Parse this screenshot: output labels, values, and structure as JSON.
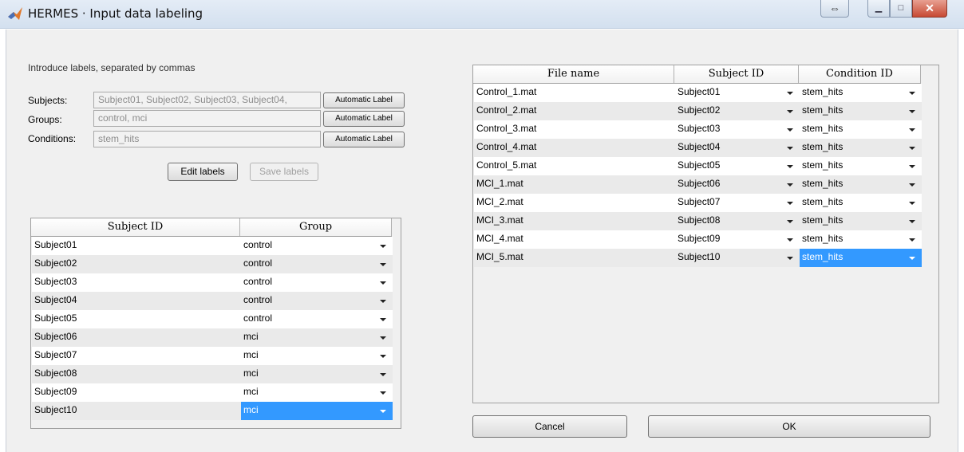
{
  "window": {
    "title": "HERMES · Input data labeling"
  },
  "labels_panel": {
    "instruction": "Introduce labels, separated by commas",
    "subjects_label": "Subjects:",
    "subjects_value": "Subject01, Subject02, Subject03, Subject04,",
    "groups_label": "Groups:",
    "groups_value": "control, mci",
    "conditions_label": "Conditions:",
    "conditions_value": "stem_hits",
    "automatic_label": "Automatic Label",
    "edit_labels": "Edit labels",
    "save_labels": "Save labels"
  },
  "subject_table": {
    "headers": [
      "Subject ID",
      "Group"
    ],
    "rows": [
      {
        "subject": "Subject01",
        "group": "control"
      },
      {
        "subject": "Subject02",
        "group": "control"
      },
      {
        "subject": "Subject03",
        "group": "control"
      },
      {
        "subject": "Subject04",
        "group": "control"
      },
      {
        "subject": "Subject05",
        "group": "control"
      },
      {
        "subject": "Subject06",
        "group": "mci"
      },
      {
        "subject": "Subject07",
        "group": "mci"
      },
      {
        "subject": "Subject08",
        "group": "mci"
      },
      {
        "subject": "Subject09",
        "group": "mci"
      },
      {
        "subject": "Subject10",
        "group": "mci"
      }
    ]
  },
  "file_table": {
    "headers": [
      "File name",
      "Subject ID",
      "Condition ID"
    ],
    "rows": [
      {
        "file": "Control_1.mat",
        "subject": "Subject01",
        "condition": "stem_hits"
      },
      {
        "file": "Control_2.mat",
        "subject": "Subject02",
        "condition": "stem_hits"
      },
      {
        "file": "Control_3.mat",
        "subject": "Subject03",
        "condition": "stem_hits"
      },
      {
        "file": "Control_4.mat",
        "subject": "Subject04",
        "condition": "stem_hits"
      },
      {
        "file": "Control_5.mat",
        "subject": "Subject05",
        "condition": "stem_hits"
      },
      {
        "file": "MCI_1.mat",
        "subject": "Subject06",
        "condition": "stem_hits"
      },
      {
        "file": "MCI_2.mat",
        "subject": "Subject07",
        "condition": "stem_hits"
      },
      {
        "file": "MCI_3.mat",
        "subject": "Subject08",
        "condition": "stem_hits"
      },
      {
        "file": "MCI_4.mat",
        "subject": "Subject09",
        "condition": "stem_hits"
      },
      {
        "file": "MCI_5.mat",
        "subject": "Subject10",
        "condition": "stem_hits"
      }
    ]
  },
  "actions": {
    "cancel": "Cancel",
    "ok": "OK"
  },
  "colors": {
    "selection": "#3399ff",
    "title_bar": "#d9e4f1",
    "panel": "#f0f0f0"
  }
}
